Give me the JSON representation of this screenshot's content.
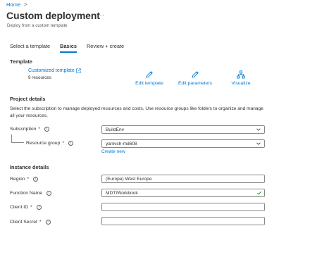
{
  "breadcrumb": {
    "home": "Home",
    "separator": ">"
  },
  "header": {
    "title": "Custom deployment",
    "more": "···",
    "subtitle": "Deploy from a custom template"
  },
  "tabs": [
    {
      "label": "Select a template"
    },
    {
      "label": "Basics"
    },
    {
      "label": "Review + create"
    }
  ],
  "template": {
    "heading": "Template",
    "name": "Customized template",
    "resources": "9 resources",
    "actions": {
      "edit_template": "Edit template",
      "edit_parameters": "Edit parameters",
      "visualize": "Visualize"
    }
  },
  "project": {
    "heading": "Project details",
    "description": "Select the subscription to manage deployed resources and costs. Use resource groups like folders to organize and manage all your resources.",
    "subscription_label": "Subscription",
    "subscription_value": "BuildEnv",
    "resource_group_label": "Resource group",
    "resource_group_value": "yanivsh-md608",
    "create_new": "Create new"
  },
  "instance": {
    "heading": "Instance details",
    "region_label": "Region",
    "region_value": "(Europe) West Europe",
    "function_name_label": "Function Name",
    "function_name_value": "MDTIWorkbook",
    "client_id_label": "Client ID",
    "client_id_value": "",
    "client_secret_label": "Client Secret",
    "client_secret_value": ""
  },
  "icons": {
    "external_link": "external-link-icon",
    "pencil": "pencil-icon",
    "visualize": "visualize-icon",
    "info": "info-icon",
    "chevron": "chevron-down-icon",
    "check": "checkmark-icon"
  },
  "colors": {
    "accent": "#0078d4",
    "text": "#323130",
    "muted": "#605e5c",
    "success": "#107c10"
  }
}
